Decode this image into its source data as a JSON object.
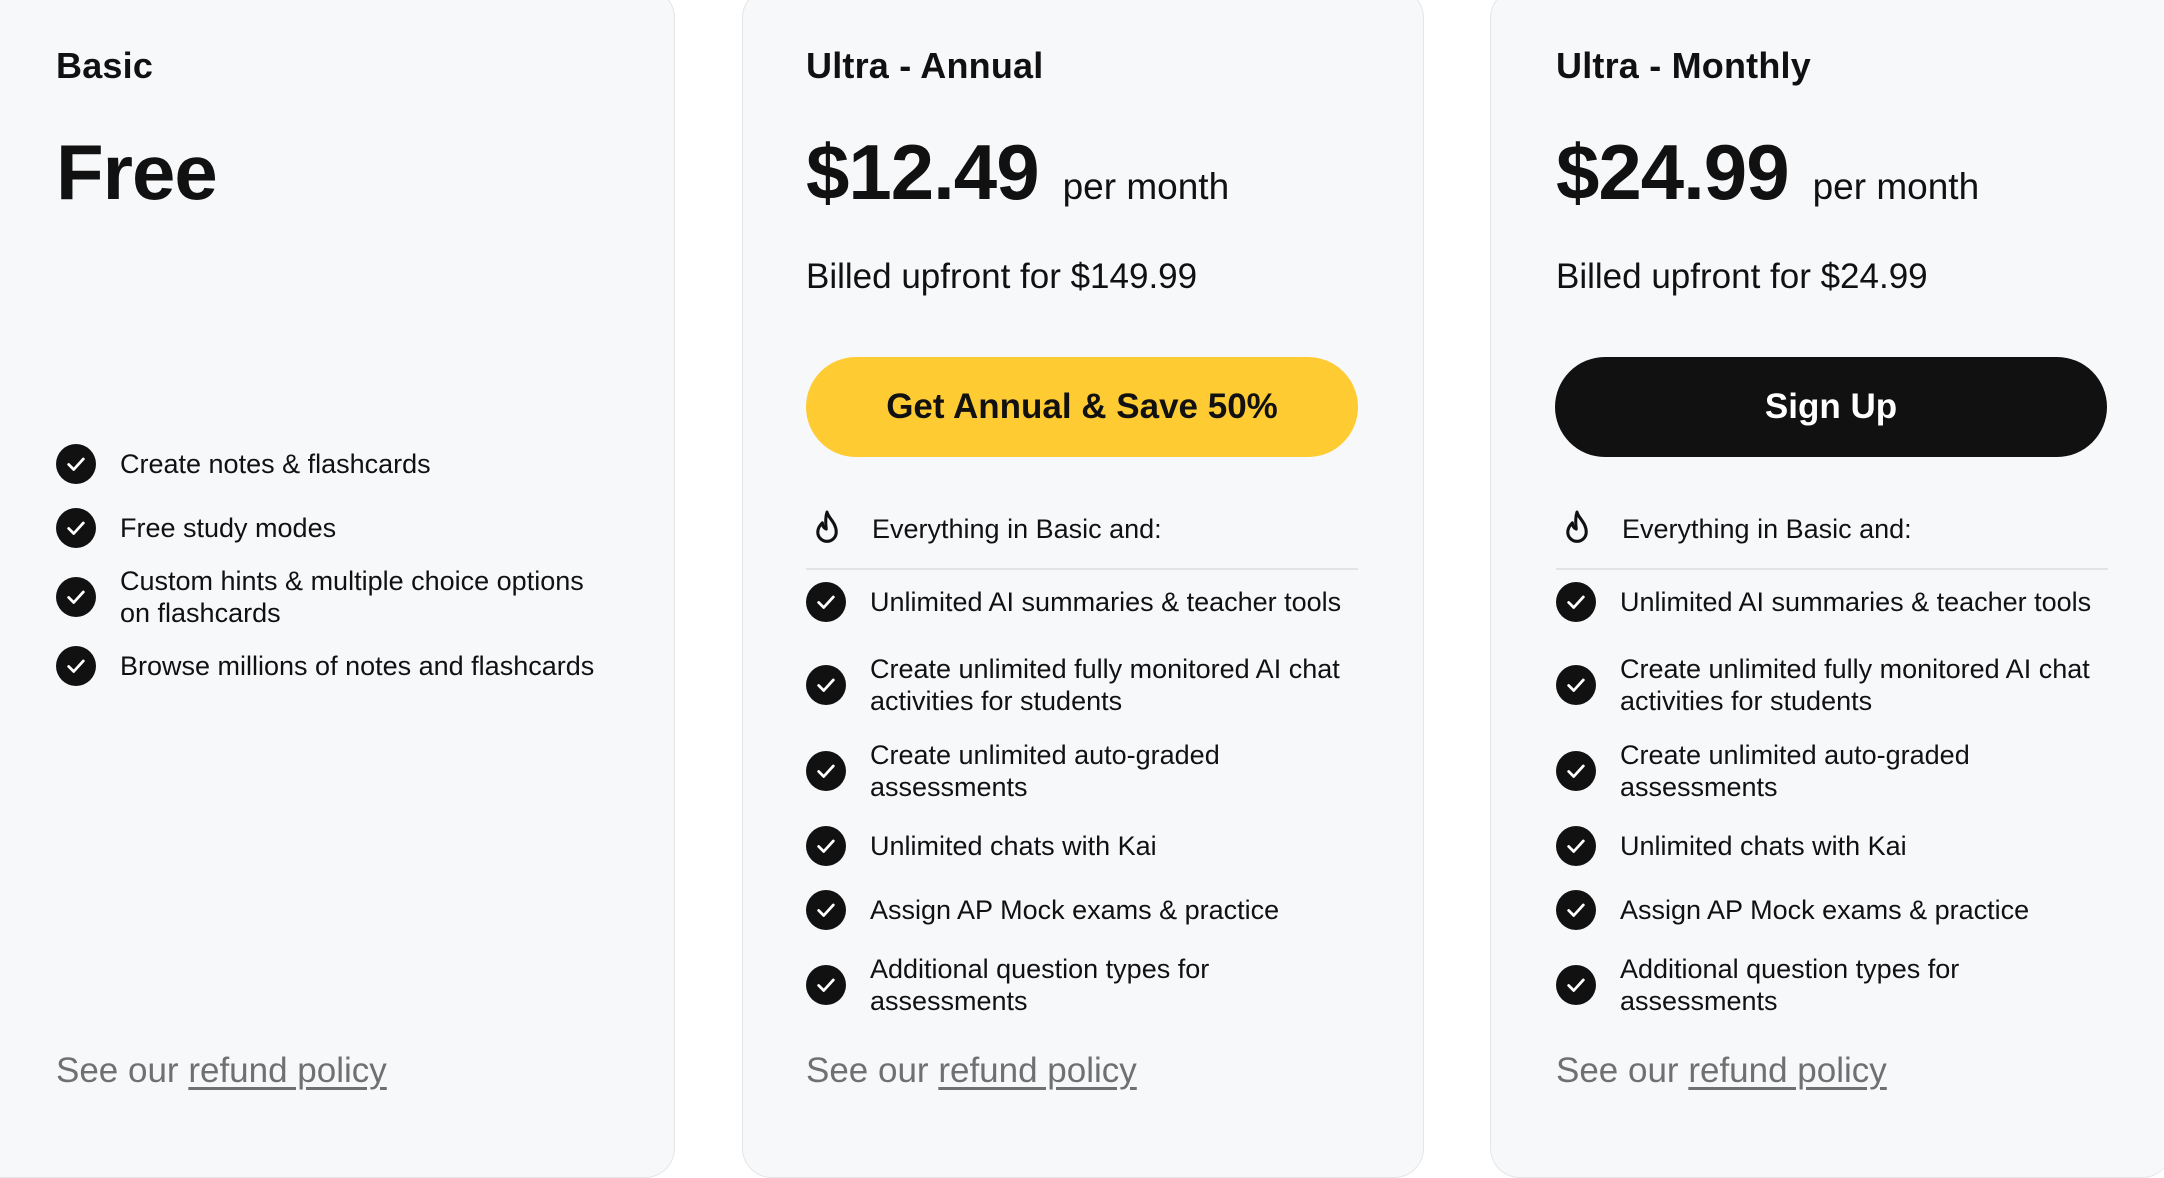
{
  "colors": {
    "accent_yellow": "#ffcb32",
    "primary_black": "#111111",
    "card_bg": "#f7f8fa",
    "muted_text": "#707070"
  },
  "basic": {
    "name": "Basic",
    "price": "Free",
    "features": [
      "Create notes & flashcards",
      "Free study modes",
      "Custom hints & multiple choice options on flashcards",
      "Browse millions of notes and flashcards"
    ],
    "refund_prefix": "See our",
    "refund_link": "refund policy"
  },
  "annual": {
    "name": "Ultra - Annual",
    "price": "$12.49",
    "per": "per month",
    "billed": "Billed upfront for $149.99",
    "cta": "Get Annual & Save 50%",
    "everything": "Everything in Basic and:",
    "features": [
      "Unlimited AI summaries & teacher tools",
      "Create unlimited fully monitored AI chat activities for students",
      "Create unlimited auto-graded assessments",
      "Unlimited chats with Kai",
      "Assign AP Mock exams & practice",
      "Additional question types for assessments"
    ],
    "refund_prefix": "See our",
    "refund_link": "refund policy"
  },
  "monthly": {
    "name": "Ultra - Monthly",
    "price": "$24.99",
    "per": "per month",
    "billed": "Billed upfront for $24.99",
    "cta": "Sign Up",
    "everything": "Everything in Basic and:",
    "features": [
      "Unlimited AI summaries & teacher tools",
      "Create unlimited fully monitored AI chat activities for students",
      "Create unlimited auto-graded assessments",
      "Unlimited chats with Kai",
      "Assign AP Mock exams & practice",
      "Additional question types for assessments"
    ],
    "refund_prefix": "See our",
    "refund_link": "refund policy"
  },
  "icons": {
    "check": "check-circle-icon",
    "flame": "flame-icon"
  }
}
